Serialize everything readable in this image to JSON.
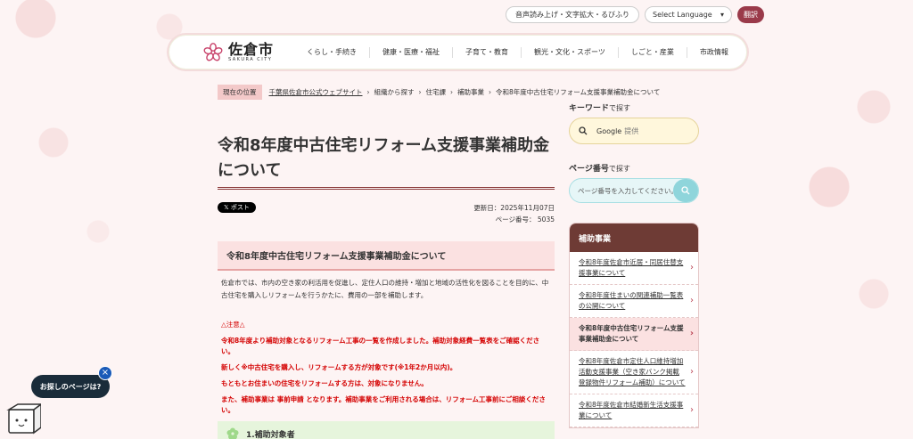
{
  "util": {
    "read_aloud": "音声読み上げ・文字拡大・るびふり",
    "language": "Select Language",
    "translate": "翻訳"
  },
  "logo": {
    "title": "佐倉市",
    "sub": "SAKURA CITY"
  },
  "nav": [
    "くらし・手続き",
    "健康・医療・福祉",
    "子育て・教育",
    "観光・文化・スポーツ",
    "しごと・産業",
    "市政情報"
  ],
  "breadcrumb": {
    "label": "現在の位置",
    "items": [
      "千葉県佐倉市公式ウェブサイト",
      "組織から探す",
      "住宅課",
      "補助事業",
      "令和8年度中古住宅リフォーム支援事業補助金について"
    ]
  },
  "main": {
    "title_line1": "令和8年度中古住宅リフォーム支援事業補助金",
    "title_line2": "について",
    "x_post": "𝕏 ポスト",
    "updated": "更新日：2025年11月07日",
    "page_no": "ページ番号： 5035",
    "h2": "令和8年度中古住宅リフォーム支援事業補助金について",
    "intro": "佐倉市では、市内の空き家の利活用を促進し、定住人口の維持・増加と地域の活性化を図ることを目的に、中古住宅を購入しリフォームを行うかたに、費用の一部を補助します。",
    "warn_title": "△注意△",
    "warn1": "令和8年度より補助対象となるリフォーム工事の一覧を作成しました。補助対象経費一覧表をご確認ください。",
    "warn2": "新しく※中古住宅を購入し、リフォームする方が対象です(※1年2か月以内)。",
    "warn3": "もともとお住まいの住宅をリフォームする方は、対象になりません。",
    "warn4": "また、補助事業は 事前申請 となります。補助事業をご利用される場合は、リフォーム工事前にご相談ください。",
    "h3": "1.補助対象者"
  },
  "side": {
    "keyword_bold": "キーワード",
    "keyword_rest": "で探す",
    "google": "Google",
    "google_sub": "提供",
    "pageno_bold": "ページ番号",
    "pageno_rest": "で探す",
    "pageno_placeholder": "ページ番号を入力してください。",
    "menu_head": "補助事業",
    "menu": [
      "令和8年度佐倉市近居・同居住替支援事業について",
      "令和8年度住まいの関連補助一覧表の公開について",
      "令和8年度中古住宅リフォーム支援事業補助金について",
      "令和8年度佐倉市定住人口維持増加活動支援事業（空き家バンク掲載登録物件リフォーム補助）について",
      "令和8年度佐倉市結婚新生活支援事業について"
    ]
  },
  "floating": {
    "label": "お探しのページは?",
    "close": "×"
  },
  "colors": {
    "accent": "#9a3a4a",
    "menu_head": "#6e3b35",
    "warning": "#d40000"
  }
}
